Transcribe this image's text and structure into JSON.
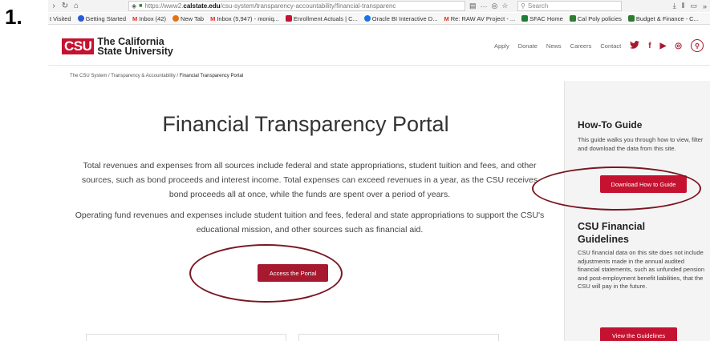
{
  "step_number": "1.",
  "browser": {
    "url_prefix": "https://www2.",
    "url_host": "calstate.edu",
    "url_path": "/csu-system/transparency-accountability/financial-transparenc",
    "search_placeholder": "Search",
    "bookmarks": [
      {
        "label": "t Visited",
        "color": "#f3f3f3"
      },
      {
        "label": "Getting Started",
        "color": "#2a5bd7"
      },
      {
        "label": "Inbox (42)",
        "color": "#d93025"
      },
      {
        "label": "New Tab",
        "color": "#e8710a"
      },
      {
        "label": "Inbox (5,947) - moniq...",
        "color": "#d93025"
      },
      {
        "label": "Enrollment Actuals | C...",
        "color": "#c41230"
      },
      {
        "label": "Oracle BI Interactive D...",
        "color": "#1a73e8"
      },
      {
        "label": "Re: RAW AV Project - ...",
        "color": "#d93025"
      },
      {
        "label": "SFAC Home",
        "color": "#1e7e34"
      },
      {
        "label": "Cal Poly policies",
        "color": "#2e7d32"
      },
      {
        "label": "Budget & Finance - C...",
        "color": "#2e7d32"
      }
    ]
  },
  "header": {
    "logo_abbr": "CSU",
    "logo_line1": "The California",
    "logo_line2": "State University",
    "links": [
      "Apply",
      "Donate",
      "News",
      "Careers",
      "Contact"
    ]
  },
  "breadcrumb": {
    "items": [
      "The CSU System",
      "Transparency & Accountability"
    ],
    "current": "Financial Transparency Portal",
    "separator": "/"
  },
  "main": {
    "title": "Financial Transparency Portal",
    "para1": "Total revenues and expenses from all sources include federal and state appropriations, student tuition and fees, and other sources, such as bond proceeds and interest income. Total expenses can exceed revenues in a year, as the CSU receives bond proceeds all at once, while the funds are spent over a period of years.",
    "para2": "Operating fund revenues and expenses include student tuition and fees, federal and state appropriations to support the CSU's educational mission, and other sources such as financial aid.",
    "portal_button": "Access the Portal"
  },
  "sidebar": {
    "howto_heading": "How-To Guide",
    "howto_text": "This guide walks you through how to view, filter and download the data from this site.",
    "howto_button": "Download How to Guide",
    "guidelines_heading": "CSU Financial Guidelines",
    "guidelines_text": "CSU financial data on this site does not include adjustments made in the annual audited financial statements, such as unfunded pension and post-employment benefit liabilities, that the CSU will pay in the future.",
    "guidelines_button": "View the Guidelines"
  },
  "colors": {
    "brand_red": "#a6192e",
    "button_red": "#c41230",
    "annotation_oval": "#7a1722"
  }
}
